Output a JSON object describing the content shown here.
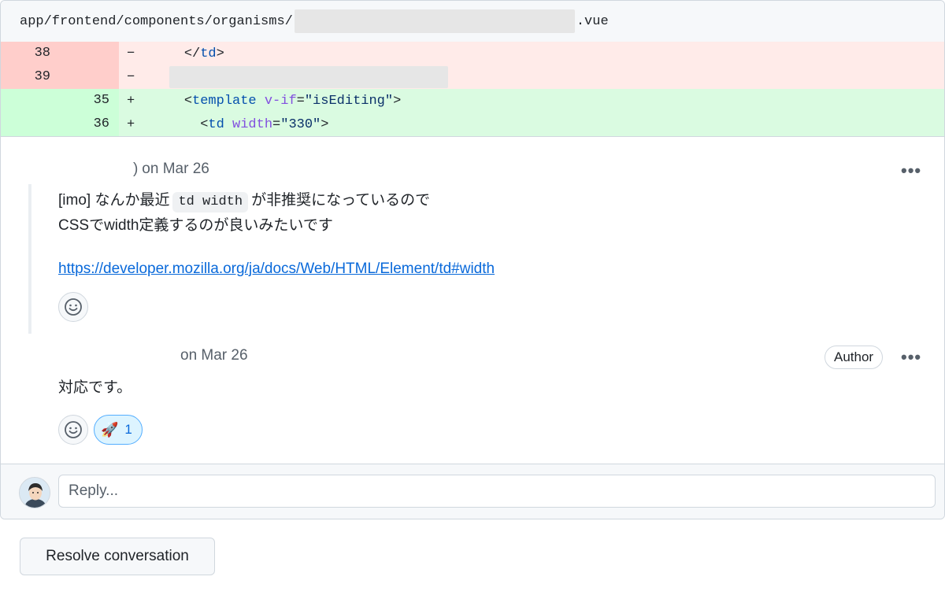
{
  "file": {
    "path_prefix": "app/frontend/components/organisms/",
    "path_suffix": ".vue"
  },
  "diff": {
    "lines": [
      {
        "type": "del",
        "old": "38",
        "new": "",
        "sign": "−",
        "indent": "    ",
        "code": [
          [
            "tag-open",
            "</"
          ],
          [
            "tag",
            "td"
          ],
          [
            "tag-open",
            ">"
          ]
        ]
      },
      {
        "type": "del",
        "old": "39",
        "new": "",
        "sign": "−",
        "redacted": true
      },
      {
        "type": "add",
        "old": "",
        "new": "35",
        "sign": "+",
        "indent": "    "
      },
      {
        "type": "add",
        "old": "",
        "new": "36",
        "sign": "+",
        "indent": "      "
      }
    ],
    "line3": {
      "open": "<",
      "tag": "template",
      "attr": "v-if",
      "eq": "=",
      "val": "\"isEditing\"",
      "close": ">"
    },
    "line4": {
      "open": "<",
      "tag": "td",
      "attr": "width",
      "eq": "=",
      "val": "\"330\"",
      "close": ">"
    }
  },
  "comments": [
    {
      "meta": "on Mar 26",
      "text_prefix": "[imo] なんか最近",
      "code": "td width",
      "text_suffix": "が非推奨になっているので",
      "line2": "CSSでwidth定義するのが良いみたいです",
      "link": "https://developer.mozilla.org/ja/docs/Web/HTML/Element/td#width",
      "menu": "•••"
    },
    {
      "meta": "on Mar 26",
      "badge": "Author",
      "text": "対応です。",
      "menu": "•••",
      "reaction_emoji": "🚀",
      "reaction_count": "1"
    }
  ],
  "reply": {
    "placeholder": "Reply..."
  },
  "actions": {
    "resolve": "Resolve conversation"
  },
  "icons": {
    "add_reaction": "smiley-icon",
    "menu": "kebab-horizontal-icon",
    "avatar": "user-avatar"
  }
}
